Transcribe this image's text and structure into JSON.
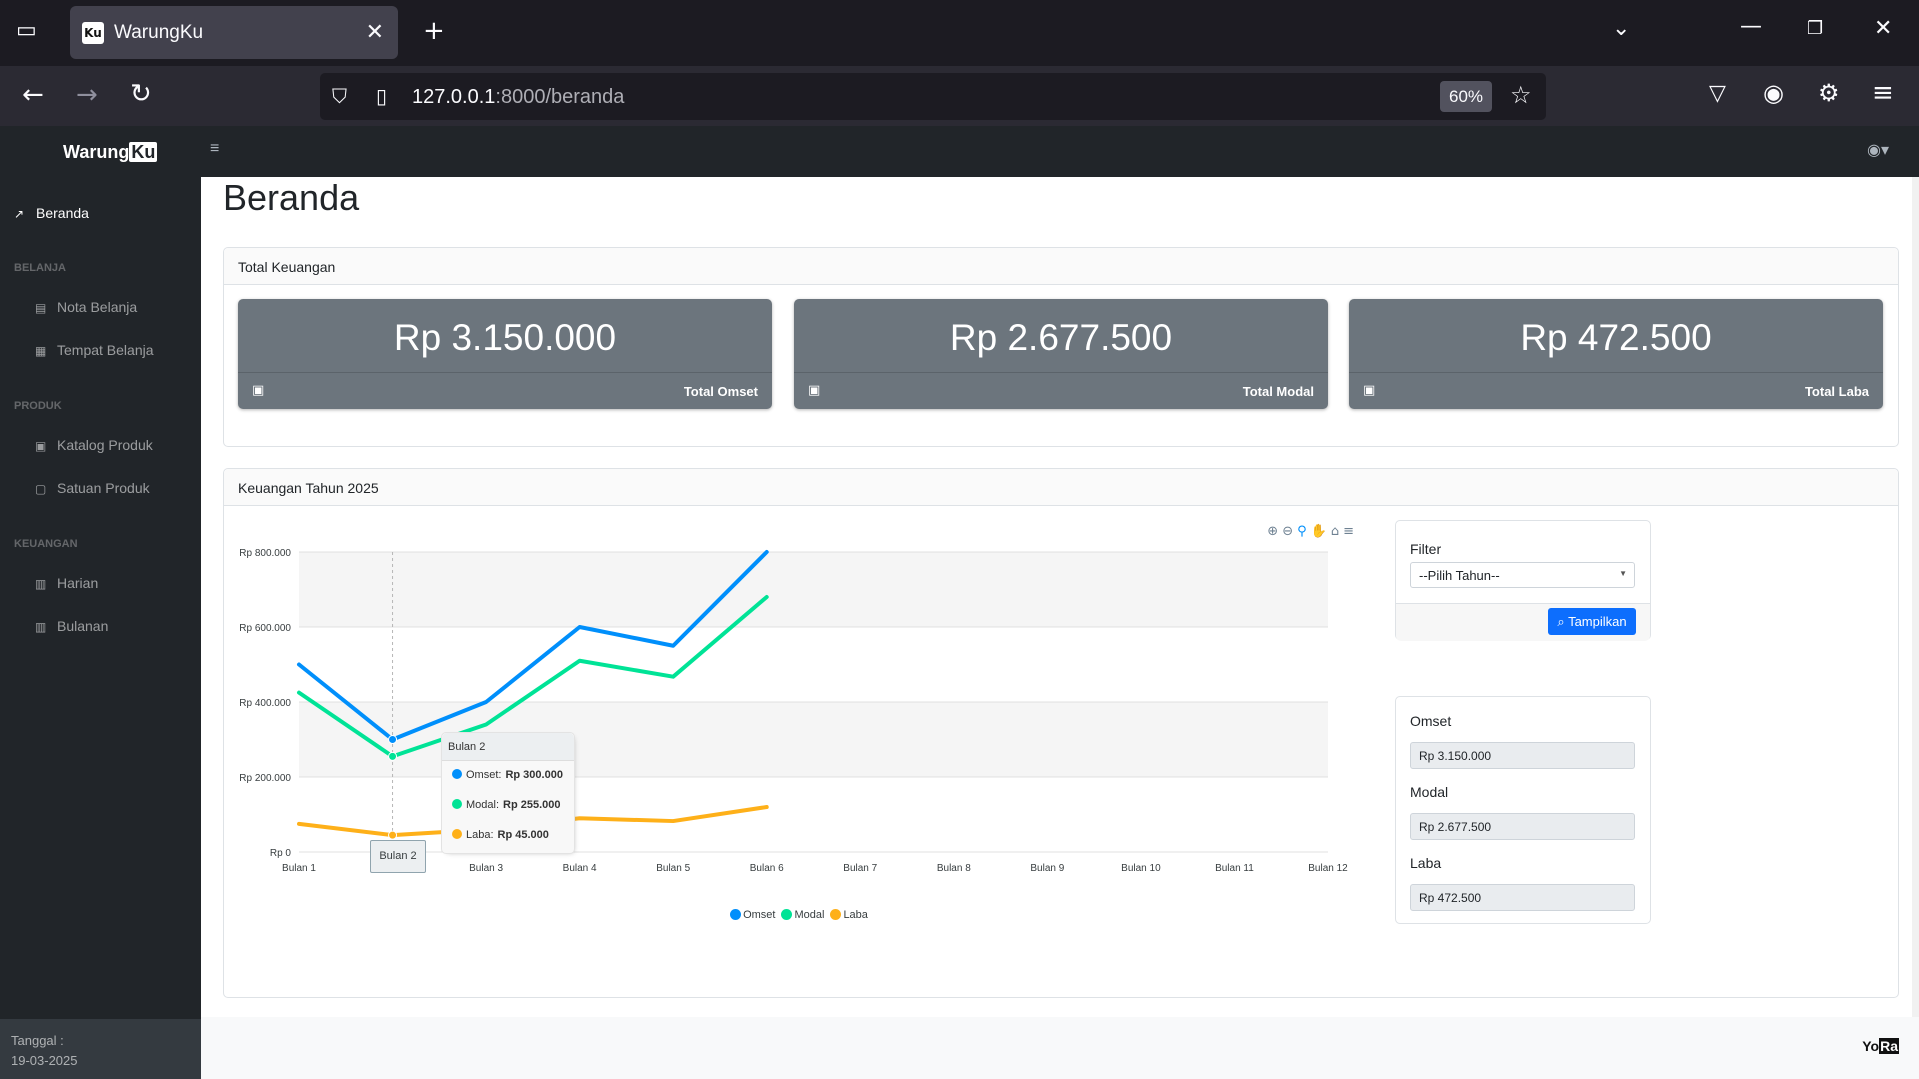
{
  "browser": {
    "tab_title": "WarungKu",
    "favicon_text": "Ku",
    "url_host": "127.0.0.1",
    "url_path": ":8000/beranda",
    "zoom": "60%"
  },
  "app": {
    "brand_main": "Warung",
    "brand_ku": "Ku"
  },
  "sidebar": {
    "beranda": "Beranda",
    "headings": {
      "belanja": "BELANJA",
      "produk": "PRODUK",
      "keuangan": "KEUANGAN"
    },
    "items": {
      "nota_belanja": "Nota Belanja",
      "tempat_belanja": "Tempat Belanja",
      "katalog_produk": "Katalog Produk",
      "satuan_produk": "Satuan Produk",
      "harian": "Harian",
      "bulanan": "Bulanan"
    },
    "footer_label": "Tanggal :",
    "footer_date": "19-03-2025"
  },
  "page": {
    "title": "Beranda",
    "summary_card_title": "Total Keuangan",
    "stats": {
      "omset_value": "Rp 3.150.000",
      "omset_label": "Total Omset",
      "modal_value": "Rp 2.677.500",
      "modal_label": "Total Modal",
      "laba_value": "Rp 472.500",
      "laba_label": "Total Laba"
    },
    "chart_card_title": "Keuangan Tahun 2025"
  },
  "chart_tooltip": {
    "title": "Bulan 2",
    "omset_label": "Omset:",
    "omset_value": "Rp 300.000",
    "modal_label": "Modal:",
    "modal_value": "Rp 255.000",
    "laba_label": "Laba:",
    "laba_value": "Rp 45.000",
    "xaxis_label": "Bulan 2"
  },
  "filter": {
    "label": "Filter",
    "select_value": "--Pilih Tahun--",
    "button_label": "Tampilkan"
  },
  "totals_panel": {
    "omset_label": "Omset",
    "omset_value": "Rp 3.150.000",
    "modal_label": "Modal",
    "modal_value": "Rp 2.677.500",
    "laba_label": "Laba",
    "laba_value": "Rp 472.500"
  },
  "footer_logo": {
    "yo": "Yo",
    "ra": "Ra"
  },
  "colors": {
    "omset": "#008ffb",
    "modal": "#00e396",
    "laba": "#feb019",
    "stat_card_bg": "#6c757d",
    "primary_button": "#0d6efd"
  },
  "chart_data": {
    "type": "line",
    "categories": [
      "Bulan 1",
      "Bulan 2",
      "Bulan 3",
      "Bulan 4",
      "Bulan 5",
      "Bulan 6",
      "Bulan 7",
      "Bulan 8",
      "Bulan 9",
      "Bulan 10",
      "Bulan 11",
      "Bulan 12"
    ],
    "series": [
      {
        "name": "Omset",
        "color": "#008ffb",
        "values": [
          500000,
          300000,
          400000,
          600000,
          550000,
          800000,
          null,
          null,
          null,
          null,
          null,
          null
        ]
      },
      {
        "name": "Modal",
        "color": "#00e396",
        "values": [
          425000,
          255000,
          340000,
          510000,
          467500,
          680000,
          null,
          null,
          null,
          null,
          null,
          null
        ]
      },
      {
        "name": "Laba",
        "color": "#feb019",
        "values": [
          75000,
          45000,
          60000,
          90000,
          82500,
          120000,
          null,
          null,
          null,
          null,
          null,
          null
        ]
      }
    ],
    "ylim": [
      0,
      800000
    ],
    "yticks": [
      "Rp 0",
      "Rp 200.000",
      "Rp 400.000",
      "Rp 600.000",
      "Rp 800.000"
    ],
    "legend_position": "bottom",
    "grid": true,
    "hovered_category": "Bulan 2"
  }
}
